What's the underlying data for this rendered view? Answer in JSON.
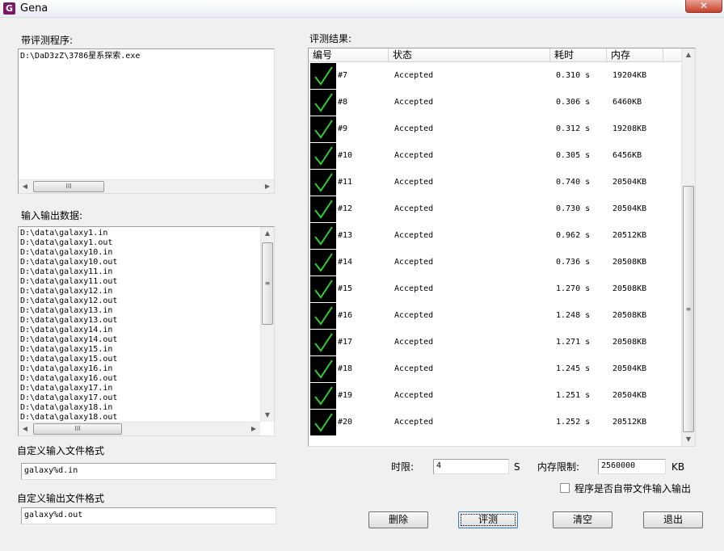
{
  "window": {
    "title": "Gena",
    "app_icon_letter": "G",
    "close_glyph": "✕"
  },
  "program": {
    "label": "带评测程序:",
    "path": "D:\\DaD3zZ\\3786星系探索.exe"
  },
  "io_data": {
    "label": "输入输出数据:",
    "files": [
      "D:\\data\\galaxy1.in",
      "D:\\data\\galaxy1.out",
      "D:\\data\\galaxy10.in",
      "D:\\data\\galaxy10.out",
      "D:\\data\\galaxy11.in",
      "D:\\data\\galaxy11.out",
      "D:\\data\\galaxy12.in",
      "D:\\data\\galaxy12.out",
      "D:\\data\\galaxy13.in",
      "D:\\data\\galaxy13.out",
      "D:\\data\\galaxy14.in",
      "D:\\data\\galaxy14.out",
      "D:\\data\\galaxy15.in",
      "D:\\data\\galaxy15.out",
      "D:\\data\\galaxy16.in",
      "D:\\data\\galaxy16.out",
      "D:\\data\\galaxy17.in",
      "D:\\data\\galaxy17.out",
      "D:\\data\\galaxy18.in",
      "D:\\data\\galaxy18.out"
    ]
  },
  "custom_input": {
    "label": "自定义输入文件格式",
    "value": "galaxy%d.in"
  },
  "custom_output": {
    "label": "自定义输出文件格式",
    "value": "galaxy%d.out"
  },
  "results": {
    "label": "评测结果:",
    "columns": [
      "编号",
      "状态",
      "耗时",
      "内存"
    ],
    "rows": [
      {
        "id": "#7",
        "status": "Accepted",
        "time": "0.310 s",
        "memory": "19204KB"
      },
      {
        "id": "#8",
        "status": "Accepted",
        "time": "0.306 s",
        "memory": "6460KB"
      },
      {
        "id": "#9",
        "status": "Accepted",
        "time": "0.312 s",
        "memory": "19208KB"
      },
      {
        "id": "#10",
        "status": "Accepted",
        "time": "0.305 s",
        "memory": "6456KB"
      },
      {
        "id": "#11",
        "status": "Accepted",
        "time": "0.740 s",
        "memory": "20504KB"
      },
      {
        "id": "#12",
        "status": "Accepted",
        "time": "0.730 s",
        "memory": "20504KB"
      },
      {
        "id": "#13",
        "status": "Accepted",
        "time": "0.962 s",
        "memory": "20512KB"
      },
      {
        "id": "#14",
        "status": "Accepted",
        "time": "0.736 s",
        "memory": "20508KB"
      },
      {
        "id": "#15",
        "status": "Accepted",
        "time": "1.270 s",
        "memory": "20508KB"
      },
      {
        "id": "#16",
        "status": "Accepted",
        "time": "1.248 s",
        "memory": "20508KB"
      },
      {
        "id": "#17",
        "status": "Accepted",
        "time": "1.271 s",
        "memory": "20508KB"
      },
      {
        "id": "#18",
        "status": "Accepted",
        "time": "1.245 s",
        "memory": "20504KB"
      },
      {
        "id": "#19",
        "status": "Accepted",
        "time": "1.251 s",
        "memory": "20504KB"
      },
      {
        "id": "#20",
        "status": "Accepted",
        "time": "1.252 s",
        "memory": "20512KB"
      }
    ],
    "status_icon": "check-icon",
    "accept_color": "#2ecc2e"
  },
  "limits": {
    "time_label": "时限:",
    "time_value": "4",
    "time_unit": "S",
    "memory_label": "内存限制:",
    "memory_value": "2560000",
    "memory_unit": "KB"
  },
  "options": {
    "own_file_io_label": "程序是否自带文件输入输出",
    "own_file_io_checked": false
  },
  "buttons": {
    "delete": "删除",
    "judge": "评测",
    "clear": "清空",
    "exit": "退出"
  },
  "scroll_glyphs": {
    "left": "◀",
    "right": "▶",
    "up": "▲",
    "down": "▼",
    "grip_h": "III",
    "grip_v": "≡"
  }
}
